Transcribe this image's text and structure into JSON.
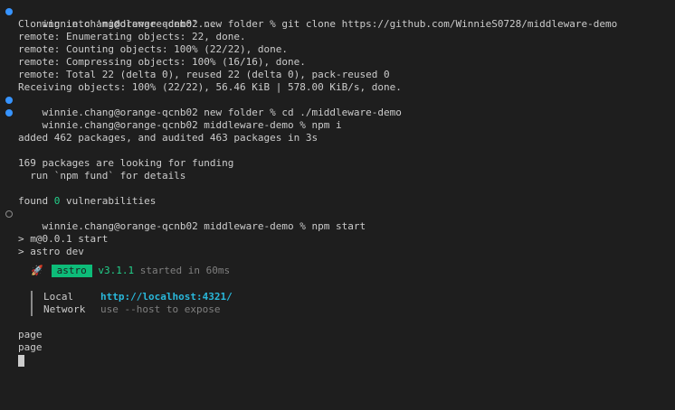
{
  "commands": {
    "clone": "winnie.chang@orange-qcnb02 new folder % git clone https://github.com/WinnieS0728/middleware-demo",
    "cd": "winnie.chang@orange-qcnb02 new folder % cd ./middleware-demo",
    "install": "winnie.chang@orange-qcnb02 middleware-demo % npm i",
    "start": "winnie.chang@orange-qcnb02 middleware-demo % npm start"
  },
  "clone_output": [
    "Cloning into 'middleware-demo'...",
    "remote: Enumerating objects: 22, done.",
    "remote: Counting objects: 100% (22/22), done.",
    "remote: Compressing objects: 100% (16/16), done.",
    "remote: Total 22 (delta 0), reused 22 (delta 0), pack-reused 0",
    "Receiving objects: 100% (22/22), 56.46 KiB | 578.00 KiB/s, done."
  ],
  "install_output": {
    "added": "added 462 packages, and audited 463 packages in 3s",
    "funding": "169 packages are looking for funding",
    "fund_hint": "  run `npm fund` for details",
    "found_prefix": "found ",
    "found_count": "0",
    "found_suffix": " vulnerabilities"
  },
  "start_output": {
    "script": "> m@0.0.1 start",
    "astro_dev": "> astro dev"
  },
  "astro": {
    "rocket": "🚀",
    "badge": "astro",
    "version": "v3.1.1",
    "started": " started in 60ms",
    "local_label": "Local",
    "local_url": "http://localhost:4321/",
    "network_label": "Network",
    "network_hint": "use --host to expose"
  },
  "page_logs": [
    "page",
    "page"
  ],
  "colors": {
    "background": "#1e1e1e",
    "text": "#cccccc",
    "success_marker": "#3794ff",
    "badge_green": "#0dbc79",
    "link": "#29b8db"
  }
}
